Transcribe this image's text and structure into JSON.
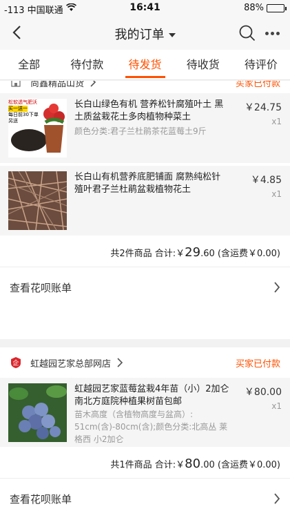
{
  "status_bar": {
    "carrier": "-113 中国联通",
    "time": "16:41",
    "battery": "88%",
    "battery_level": 0.88
  },
  "nav": {
    "title": "我的订单"
  },
  "tabs": [
    {
      "label": "全部"
    },
    {
      "label": "待付款"
    },
    {
      "label": "待发货"
    },
    {
      "label": "待收货"
    },
    {
      "label": "待评价"
    }
  ],
  "active_tab": 2,
  "orders": [
    {
      "shop_name": "尚鑫精品山货",
      "status": "买家已付款",
      "items": [
        {
          "name": "长白山绿色有机 营养松针腐殖叶土 黑土质盆栽花土多肉植物种菜土",
          "spec": "颜色分类:君子兰杜鹃茶花蓝莓土9斤",
          "price": "￥24.75",
          "qty": "x1",
          "thumb_text": [
            "松软透气肥沃",
            "买一送一",
            "每日前30下单",
            "另送"
          ]
        },
        {
          "name": "长白山有机营养底肥铺面 腐熟纯松针殖叶君子兰杜鹃盆栽植物花土",
          "spec": "",
          "price": "￥4.85",
          "qty": "x1",
          "thumb_text": []
        }
      ],
      "summary": {
        "count_text": "共2件商品 合计:",
        "currency": "￥",
        "amount_int": "29",
        "amount_dec": ".60",
        "shipping": "(含运费￥0.00)"
      },
      "bill_link": "查看花呗账单"
    },
    {
      "shop_name": "虹越园艺家总部网店",
      "status": "买家已付款",
      "items": [
        {
          "name": "虹越园艺家蓝莓盆栽4年苗（小）2加仑南北方庭院种植果树苗包邮",
          "spec": "苗木高度（含植物高度与盆高）: 51cm(含)-80cm(含);颜色分类:北高丛 莱格西 小2加仑",
          "price": "￥80.00",
          "qty": "x1",
          "thumb_text": []
        }
      ],
      "summary": {
        "count_text": "共1件商品 合计:",
        "currency": "￥",
        "amount_int": "80",
        "amount_dec": ".00",
        "shipping": "(含运费￥0.00)"
      },
      "bill_link": "查看花呗账单"
    }
  ],
  "colors": {
    "accent": "#ff5000",
    "muted": "#999999"
  }
}
